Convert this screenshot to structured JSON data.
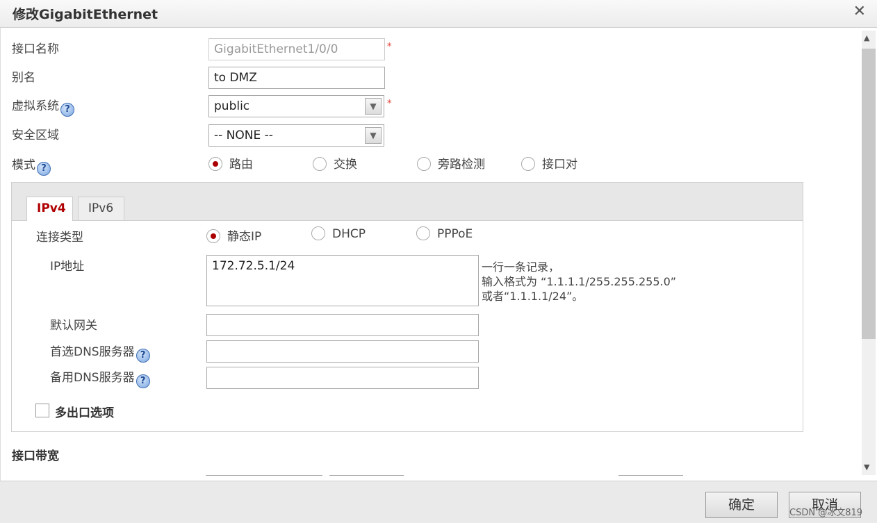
{
  "dialog": {
    "title": "修改GigabitEthernet",
    "close_glyph": "✕"
  },
  "form": {
    "interface_name_label": "接口名称",
    "interface_name_value": "GigabitEthernet1/0/0",
    "alias_label": "别名",
    "alias_value": "to DMZ",
    "vsys_label": "虚拟系统",
    "vsys_value": "public",
    "zone_label": "安全区域",
    "zone_value": "-- NONE --",
    "mode_label": "模式",
    "mode_options": [
      "路由",
      "交换",
      "旁路检测",
      "接口对"
    ],
    "mode_selected": "路由",
    "required_mark": "*",
    "help_glyph": "?"
  },
  "tabs": [
    "IPv4",
    "IPv6"
  ],
  "ipv4": {
    "conn_type_label": "连接类型",
    "conn_options": [
      "静态IP",
      "DHCP",
      "PPPoE"
    ],
    "conn_selected": "静态IP",
    "ip_label": "IP地址",
    "ip_value": "172.72.5.1/24",
    "hint_lines": [
      "一行一条记录，",
      "输入格式为 “1.1.1.1/255.255.255.0”",
      "或者“1.1.1.1/24”。"
    ],
    "gateway_label": "默认网关",
    "dns1_label": "首选DNS服务器",
    "dns2_label": "备用DNS服务器",
    "multi_exit_label": "多出口选项"
  },
  "bandwidth_section": "接口带宽",
  "footer": {
    "ok_label": "确定",
    "cancel_label": "取消",
    "watermark": "CSDN @冰文819"
  },
  "colors": {
    "active_tab": "#b00000",
    "required": "#e0443a"
  }
}
